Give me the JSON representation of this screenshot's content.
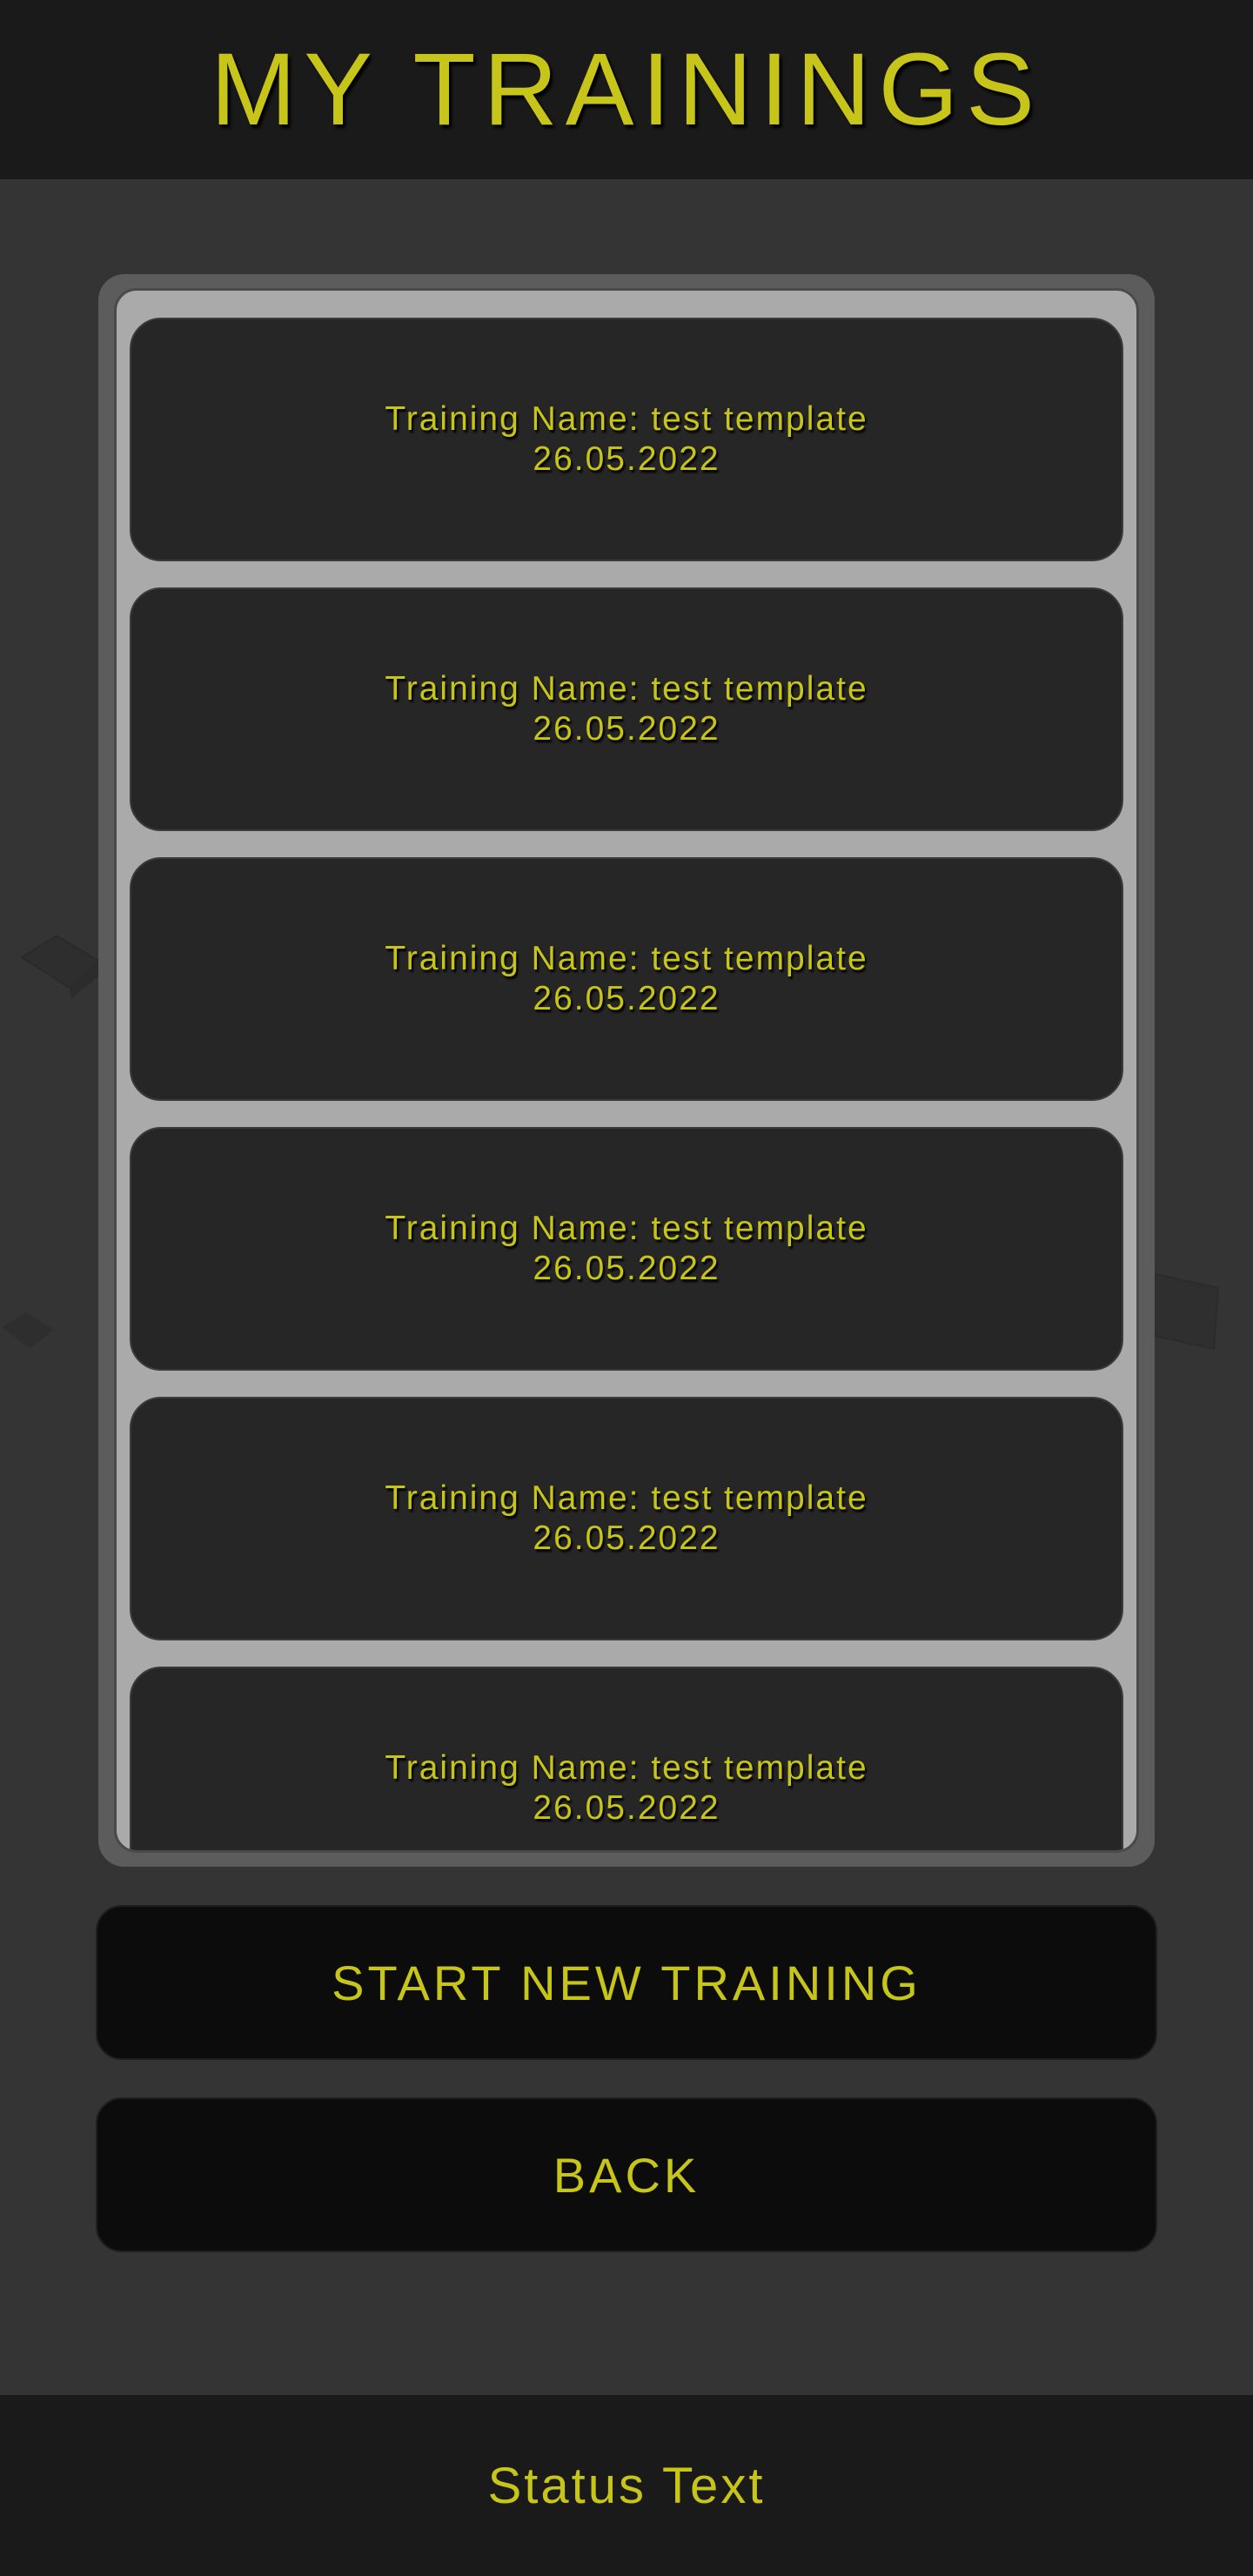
{
  "header": {
    "title": "MY TRAININGS"
  },
  "trainings": [
    {
      "name": "Training Name: test template",
      "date": "26.05.2022"
    },
    {
      "name": "Training Name: test template",
      "date": "26.05.2022"
    },
    {
      "name": "Training Name: test template",
      "date": "26.05.2022"
    },
    {
      "name": "Training Name: test template",
      "date": "26.05.2022"
    },
    {
      "name": "Training Name: test template",
      "date": "26.05.2022"
    },
    {
      "name": "Training Name: test template",
      "date": "26.05.2022"
    }
  ],
  "actions": {
    "start_label": "START NEW TRAINING",
    "back_label": "BACK"
  },
  "footer": {
    "status": "Status Text"
  },
  "colors": {
    "accent": "#c7c41a",
    "background": "#343434",
    "bar": "#1a1a1a",
    "card": "#262626",
    "list_border": "#aaaaaa"
  }
}
